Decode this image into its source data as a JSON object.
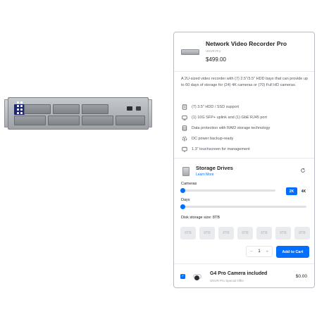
{
  "product": {
    "title": "Network Video Recorder Pro",
    "sku": "UNVR-Pro",
    "price": "$499.00",
    "description": "A 2U-sized video recorder with (7) 2.5\"/3.5\" HDD bays that can provide up to 60 days of storage for (24) 4K cameras or (70) Full HD cameras.",
    "features": [
      {
        "icon": "hdd-icon",
        "text": "(7) 3.5\" HDD / SSD support"
      },
      {
        "icon": "network-port-icon",
        "text": "(1) 10G SFP+ uplink and (1) GbE RJ45 port"
      },
      {
        "icon": "raid-storage-icon",
        "text": "Data protection with RAID storage technology"
      },
      {
        "icon": "power-backup-icon",
        "text": "DC power backup-ready"
      },
      {
        "icon": "touchscreen-icon",
        "text": "1.3\" touchscreen for management"
      }
    ]
  },
  "storage": {
    "title": "Storage Drives",
    "learn_more": "Learn More",
    "cameras_label": "Cameras",
    "cameras_value": 0,
    "days_label": "Days",
    "days_value": 0,
    "resolution_options": [
      "2K",
      "4K"
    ],
    "resolution_selected": "2K",
    "disk_size_label": "Disk storage size: 8TB",
    "disk_options": [
      "8TB",
      "8TB",
      "8TB",
      "8TB",
      "8TB",
      "8TB",
      "8TB"
    ]
  },
  "cart": {
    "quantity": "1",
    "decrement": "−",
    "increment": "+",
    "add_label": "Add to Cart"
  },
  "bundle": {
    "checked": true,
    "title": "G4 Pro Camera included",
    "subtitle": "UNVR Pro Special Offer",
    "price": "$0.00"
  },
  "colors": {
    "accent": "#006fff",
    "text": "#212327",
    "muted": "#50565e",
    "border": "#b9bdc3"
  }
}
